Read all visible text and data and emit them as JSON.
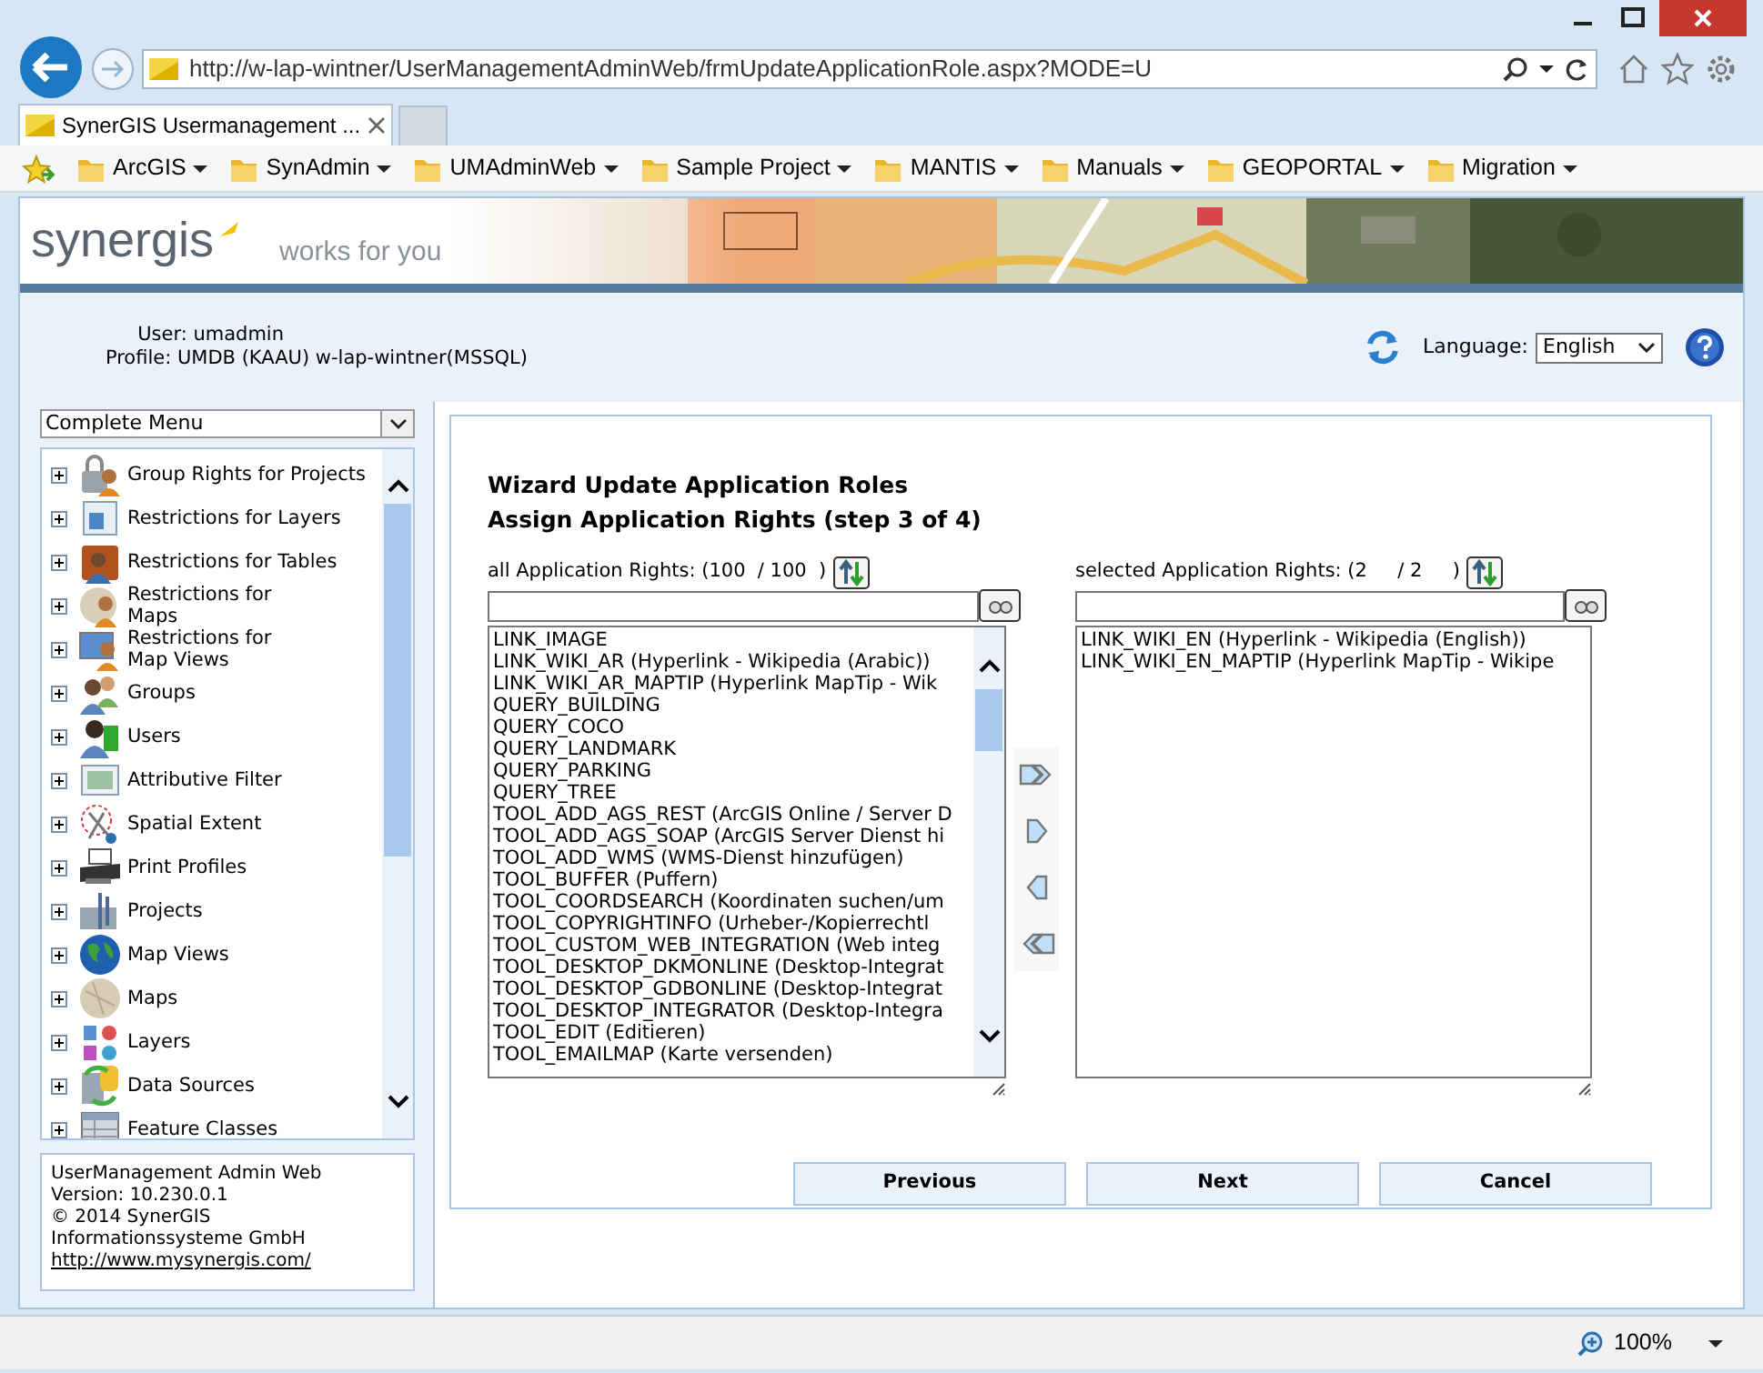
{
  "browser": {
    "address": "http://w-lap-wintner/UserManagementAdminWeb/frmUpdateApplicationRole.aspx?MODE=U",
    "tabs": [
      {
        "label": "SynerGIS Usermanagement ...",
        "selected": true
      }
    ],
    "favorites": [
      "ArcGIS",
      "SynAdmin",
      "UMAdminWeb",
      "Sample Project",
      "MANTIS",
      "Manuals",
      "GEOPORTAL",
      "Migration"
    ]
  },
  "header": {
    "logo": "synergis",
    "tagline": "works for you"
  },
  "user_info": {
    "user": "User: umadmin",
    "profile": "Profile: UMDB (KAAU) w-lap-wintner(MSSQL)"
  },
  "language": {
    "label": "Language:",
    "value": "English"
  },
  "sidebar": {
    "menu_select": "Complete Menu",
    "items": [
      {
        "label": "Group Rights for Projects",
        "expanded": false
      },
      {
        "label": "Restrictions for Layers",
        "expanded": false
      },
      {
        "label": "Restrictions for Tables",
        "expanded": false
      },
      {
        "label": "Restrictions for\nMaps",
        "expanded": false
      },
      {
        "label": "Restrictions for\nMap Views",
        "expanded": false
      },
      {
        "label": "Groups",
        "expanded": false
      },
      {
        "label": "Users",
        "expanded": false
      },
      {
        "label": "Attributive Filter",
        "expanded": false
      },
      {
        "label": "Spatial Extent",
        "expanded": false
      },
      {
        "label": "Print Profiles",
        "expanded": false
      },
      {
        "label": "Projects",
        "expanded": false
      },
      {
        "label": "Map Views",
        "expanded": false
      },
      {
        "label": "Maps",
        "expanded": false
      },
      {
        "label": "Layers",
        "expanded": false
      },
      {
        "label": "Data Sources",
        "expanded": false
      },
      {
        "label": "Feature Classes",
        "expanded": false
      }
    ],
    "footer": [
      "UserManagement Admin Web",
      "Version: 10.230.0.1",
      "© 2014 SynerGIS",
      "Informationssysteme GmbH"
    ],
    "footer_link": "http://www.mysynergis.com/"
  },
  "wizard": {
    "title": "Wizard Update Application Roles",
    "subtitle": "Assign Application Rights (step 3 of 4)",
    "available": {
      "label": "all Application Rights: (100  / 100  )",
      "items": [
        "LINK_IMAGE",
        "LINK_WIKI_AR (Hyperlink - Wikipedia (Arabic))",
        "LINK_WIKI_AR_MAPTIP (Hyperlink MapTip - Wik",
        "QUERY_BUILDING",
        "QUERY_COCO",
        "QUERY_LANDMARK",
        "QUERY_PARKING",
        "QUERY_TREE",
        "TOOL_ADD_AGS_REST (ArcGIS Online / Server D",
        "TOOL_ADD_AGS_SOAP (ArcGIS Server Dienst hi",
        "TOOL_ADD_WMS (WMS-Dienst hinzufügen)",
        "TOOL_BUFFER (Puffern)",
        "TOOL_COORDSEARCH (Koordinaten suchen/um",
        "TOOL_COPYRIGHTINFO (Urheber-/Kopierrechtl",
        "TOOL_CUSTOM_WEB_INTEGRATION (Web integ",
        "TOOL_DESKTOP_DKMONLINE (Desktop-Integrat",
        "TOOL_DESKTOP_GDBONLINE (Desktop-Integrat",
        "TOOL_DESKTOP_INTEGRATOR (Desktop-Integra",
        "TOOL_EDIT (Editieren)",
        "TOOL_EMAILMAP (Karte versenden)"
      ]
    },
    "selected": {
      "label": "selected Application Rights: (2     / 2     )",
      "items": [
        "LINK_WIKI_EN (Hyperlink - Wikipedia (English))",
        "LINK_WIKI_EN_MAPTIP (Hyperlink MapTip - Wikipe"
      ]
    },
    "buttons": [
      "Previous",
      "Next",
      "Cancel"
    ]
  },
  "status_bar": {
    "zoom": "100%"
  }
}
